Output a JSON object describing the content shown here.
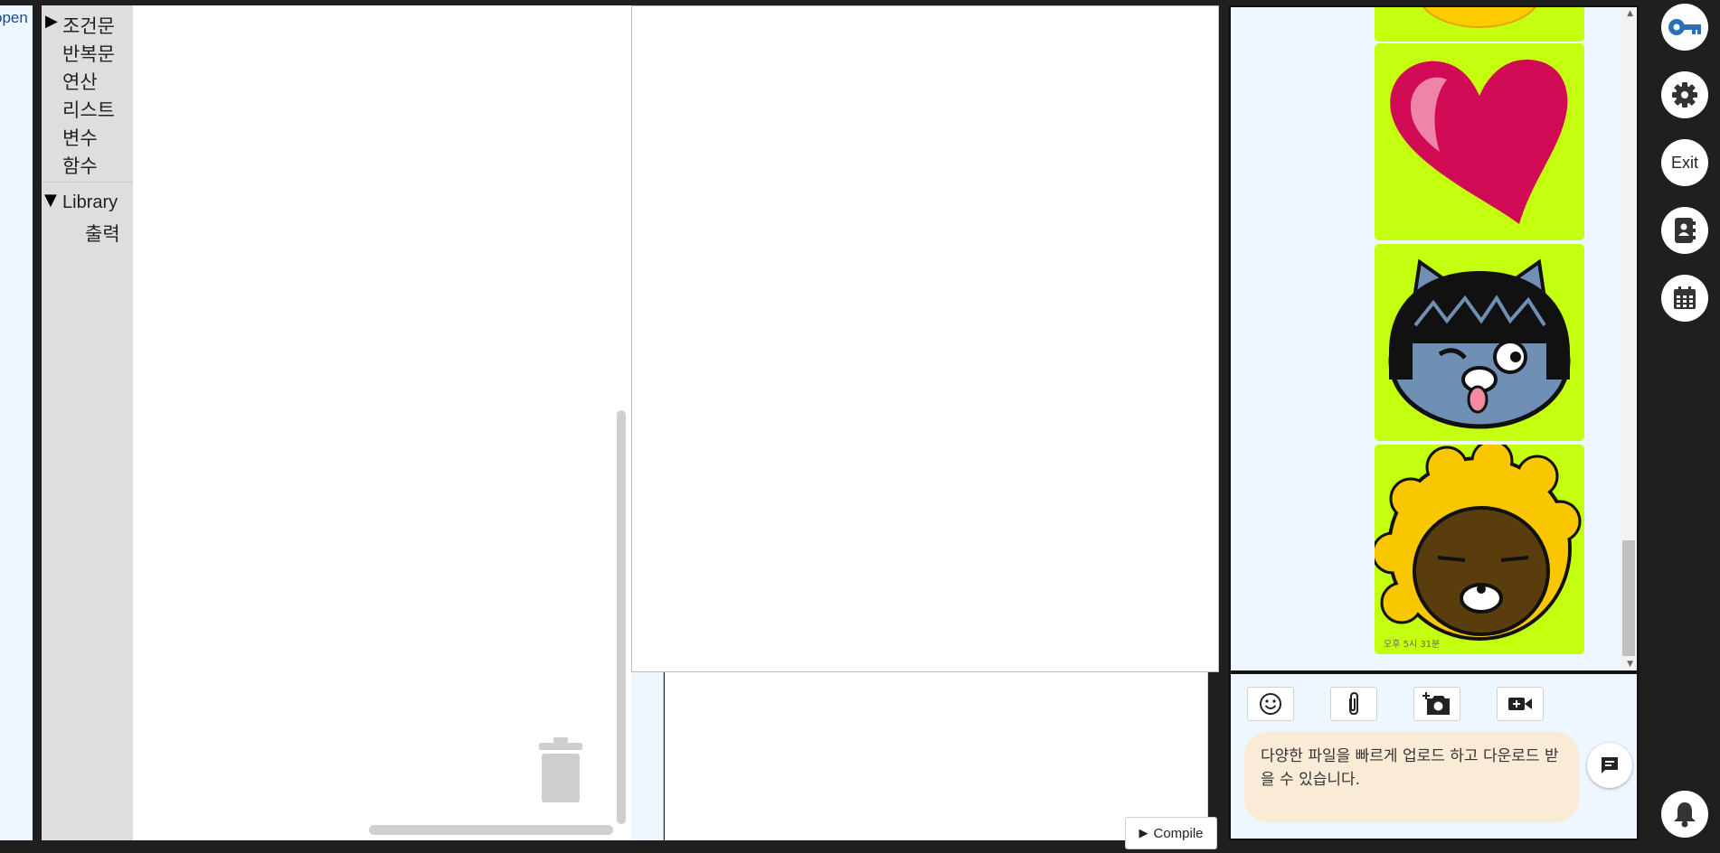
{
  "left_strip": {
    "text": "open"
  },
  "toolbox": {
    "categories": [
      {
        "label": "조건문"
      },
      {
        "label": "반복문"
      },
      {
        "label": "연산"
      },
      {
        "label": "리스트"
      },
      {
        "label": "변수"
      },
      {
        "label": "함수"
      }
    ],
    "library": {
      "label": "Library",
      "items": [
        {
          "label": "출력"
        }
      ]
    }
  },
  "compile": {
    "label": "Compile"
  },
  "chat": {
    "stickers": [
      {
        "name": "sun-sticker-partial"
      },
      {
        "name": "heart-sticker"
      },
      {
        "name": "cat-sticker"
      },
      {
        "name": "curly-hair-sticker"
      }
    ],
    "timestamp": "오후 5시 31분",
    "composer": {
      "tools": [
        "emoji-icon",
        "paperclip-icon",
        "add-photo-icon",
        "video-icon"
      ],
      "message": "다양한 파일을 빠르게 업로드 하고 다운로드 받을 수 있습니다."
    }
  },
  "rail": {
    "buttons": [
      "key-icon",
      "gear-icon",
      "exit",
      "contact-book-icon",
      "calendar-icon"
    ],
    "exit_label": "Exit",
    "bell": "bell-icon"
  },
  "colors": {
    "rail_bg": "#1f1f1f",
    "sticker_bg": "#c3ff0f",
    "bubble_bg": "#faebd7",
    "panel_bg": "#eef6ff"
  }
}
